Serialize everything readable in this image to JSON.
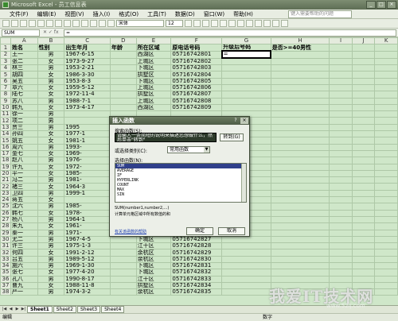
{
  "window": {
    "title": "Microsoft Excel - 员工信息表"
  },
  "menubar": {
    "items": [
      "文件(F)",
      "编辑(E)",
      "视图(V)",
      "插入(I)",
      "格式(O)",
      "工具(T)",
      "数据(D)",
      "窗口(W)",
      "帮助(H)"
    ],
    "help_placeholder": "键入需要帮助的问题"
  },
  "toolbar": {
    "font": "宋体",
    "size": "12"
  },
  "formula_bar": {
    "name_box": "SUM",
    "formula": "="
  },
  "columns": [
    "A",
    "B",
    "C",
    "D",
    "E",
    "F",
    "G",
    "H",
    "I",
    "J",
    "K"
  ],
  "headers": [
    "姓名",
    "性别",
    "出生年月",
    "年龄",
    "所在区域",
    "原电话号码",
    "升级后号码",
    "是否>=40男性"
  ],
  "rows": [
    [
      "王一",
      "男",
      "1967-6-15",
      "",
      "西湖区",
      "05716742801"
    ],
    [
      "张二",
      "女",
      "1973-9-27",
      "",
      "上城区",
      "05716742802"
    ],
    [
      "林三",
      "男",
      "1953-2-21",
      "",
      "下城区",
      "05716742803"
    ],
    [
      "胡四",
      "女",
      "1986-3-30",
      "",
      "拱墅区",
      "05716742804"
    ],
    [
      "吴五",
      "男",
      "1953-8-3",
      "",
      "下城区",
      "05716742805"
    ],
    [
      "章六",
      "女",
      "1959-5-12",
      "",
      "上城区",
      "05716742806"
    ],
    [
      "陆七",
      "女",
      "1972-11-4",
      "",
      "拱墅区",
      "05716742807"
    ],
    [
      "苏八",
      "男",
      "1988-7-1",
      "",
      "上城区",
      "05716742808"
    ],
    [
      "韩九",
      "女",
      "1973-4-17",
      "",
      "西湖区",
      "05716742809"
    ],
    [
      "徐一",
      "男",
      "",
      "",
      "",
      ""
    ],
    [
      "项二",
      "男",
      "",
      "",
      "",
      ""
    ],
    [
      "贾三",
      "男",
      "1995",
      "",
      "",
      ""
    ],
    [
      "孙四",
      "女",
      "1977-1",
      "",
      "",
      ""
    ],
    [
      "姚五",
      "女",
      "1981-1",
      "",
      "",
      ""
    ],
    [
      "周六",
      "男",
      "1993-",
      "",
      "",
      ""
    ],
    [
      "金七",
      "女",
      "1969-",
      "",
      "",
      ""
    ],
    [
      "赵八",
      "男",
      "1976-",
      "",
      "",
      ""
    ],
    [
      "许九",
      "女",
      "1972-",
      "",
      "",
      ""
    ],
    [
      "平一",
      "女",
      "1985-",
      "",
      "",
      ""
    ],
    [
      "冯二",
      "男",
      "1981-",
      "",
      "",
      ""
    ],
    [
      "褚三",
      "女",
      "1964-3",
      "",
      "",
      ""
    ],
    [
      "卫四",
      "男",
      "1999-1",
      "",
      "",
      ""
    ],
    [
      "蒋五",
      "女",
      "",
      "",
      "",
      ""
    ],
    [
      "沈六",
      "男",
      "1985-",
      "",
      "",
      ""
    ],
    [
      "韩七",
      "女",
      "1978-",
      "",
      "",
      ""
    ],
    [
      "杨八",
      "男",
      "1964-1",
      "",
      "",
      ""
    ],
    [
      "朱九",
      "女",
      "1961-",
      "",
      "",
      ""
    ],
    [
      "秦一",
      "男",
      "1971-",
      "",
      "",
      ""
    ],
    [
      "尤二",
      "男",
      "1967-4-5",
      "",
      "下城区",
      "05716742827"
    ],
    [
      "许三",
      "男",
      "1975-1-3",
      "",
      "江干区",
      "05716742828"
    ],
    [
      "何四",
      "女",
      "1991-2-12",
      "",
      "余杭区",
      "05716742829"
    ],
    [
      "吕五",
      "男",
      "1989-5-12",
      "",
      "余杭区",
      "05716742830"
    ],
    [
      "施六",
      "男",
      "1969-1-30",
      "",
      "下城区",
      "05716742831"
    ],
    [
      "张七",
      "女",
      "1977-4-20",
      "",
      "下城区",
      "05716742832"
    ],
    [
      "孔八",
      "男",
      "1990-8-17",
      "",
      "江干区",
      "05716742833"
    ],
    [
      "曹九",
      "女",
      "1988-11-8",
      "",
      "拱墅区",
      "05716742834"
    ],
    [
      "严一",
      "男",
      "1974-3-2",
      "",
      "余杭区",
      "05716742835"
    ]
  ],
  "active_cell_value": "=",
  "dialog": {
    "title": "插入函数",
    "search_label": "搜索函数(S):",
    "search_text": "请输入一条简短的说明来描述您想做什么，然后单击\"转到\"",
    "go_button": "转到(G)",
    "category_label": "或选择类别(C):",
    "category_value": "常用函数",
    "function_label": "选择函数(N):",
    "functions": [
      "SUM",
      "AVERAGE",
      "IF",
      "HYPERLINK",
      "COUNT",
      "MAX",
      "SIN"
    ],
    "signature": "SUM(number1,number2,...)",
    "description": "计算单元格区域中所有数值的和",
    "help_link": "有关该函数的帮助",
    "ok": "确定",
    "cancel": "取消"
  },
  "sheet_tabs": [
    "Sheet1",
    "Sheet2",
    "Sheet3",
    "Sheet4"
  ],
  "status": {
    "left": "编辑",
    "right": "数字"
  },
  "watermark": {
    "line1": "我爱IT技术网",
    "line2": "www.52ij.com"
  }
}
